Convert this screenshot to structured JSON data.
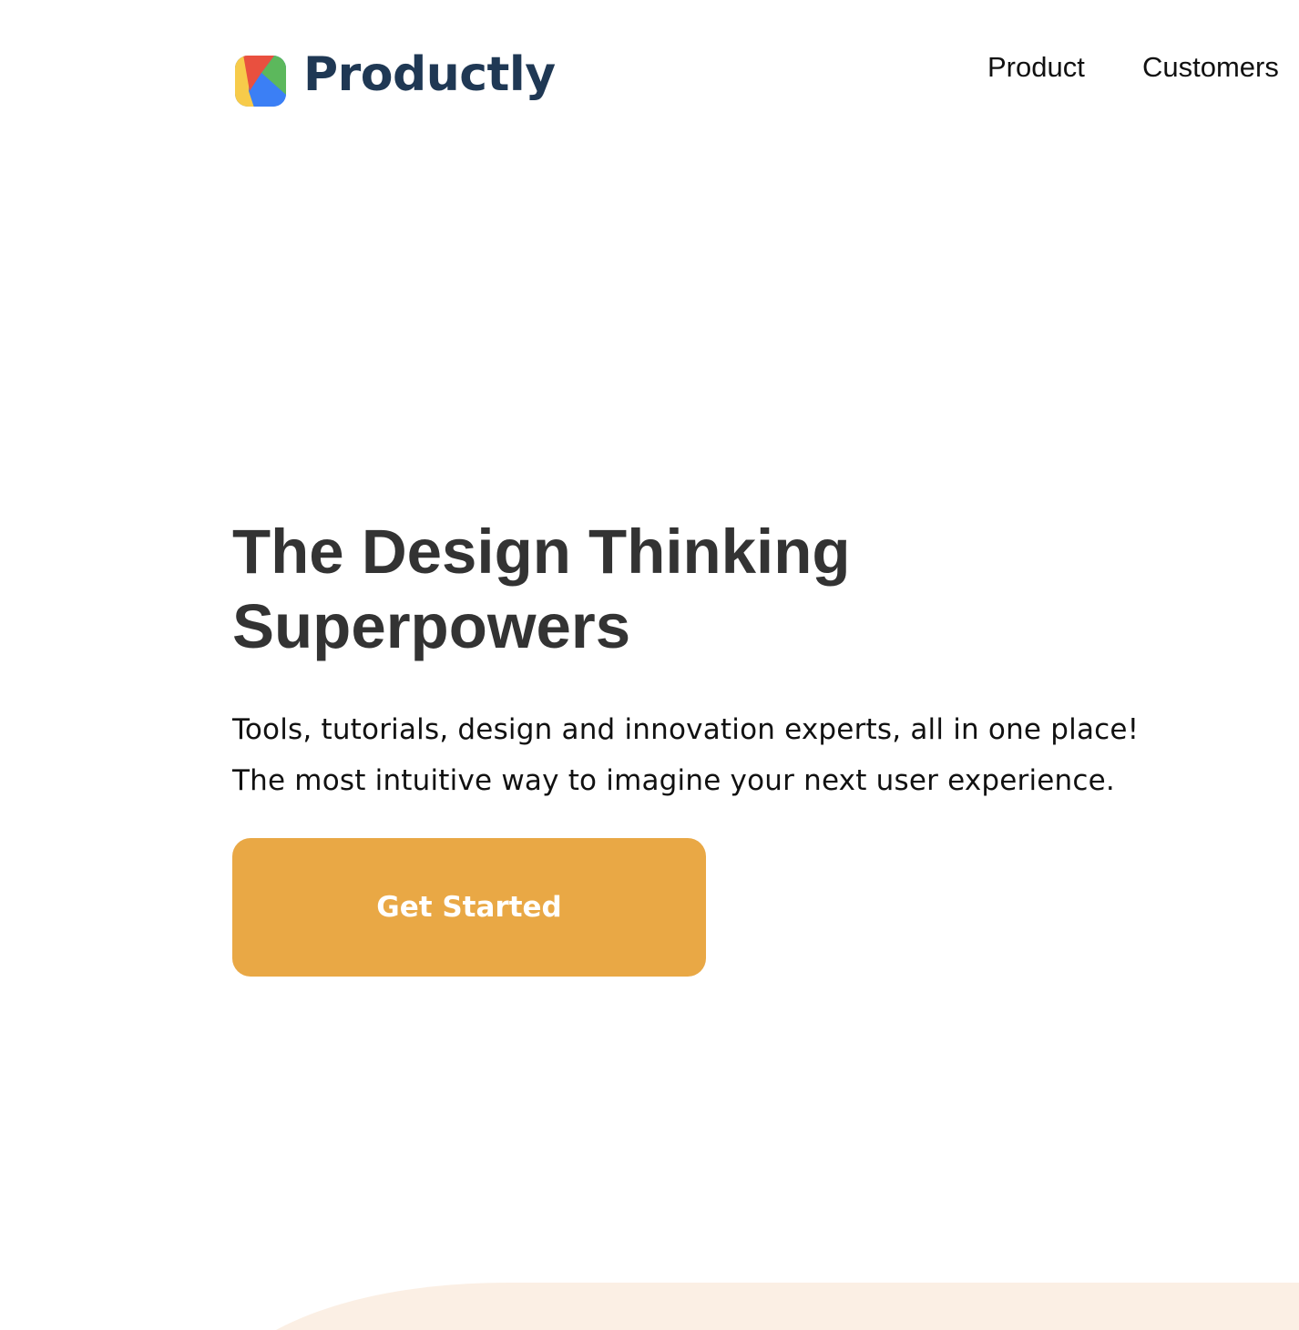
{
  "header": {
    "brand_name": "Productly",
    "logo_icon": "productly-logo-icon",
    "nav": [
      {
        "label": "Product"
      },
      {
        "label": "Customers"
      }
    ]
  },
  "hero": {
    "title": "The Design Thinking Superpowers",
    "subtitle_lines": [
      "Tools, tutorials, design and innovation experts, all in one place!",
      "The most intuitive way to imagine your next user experience."
    ],
    "cta_label": "Get Started"
  },
  "colors": {
    "brand": "#1f3854",
    "cta": "#e9a845",
    "decor_background": "#fbefe4"
  }
}
